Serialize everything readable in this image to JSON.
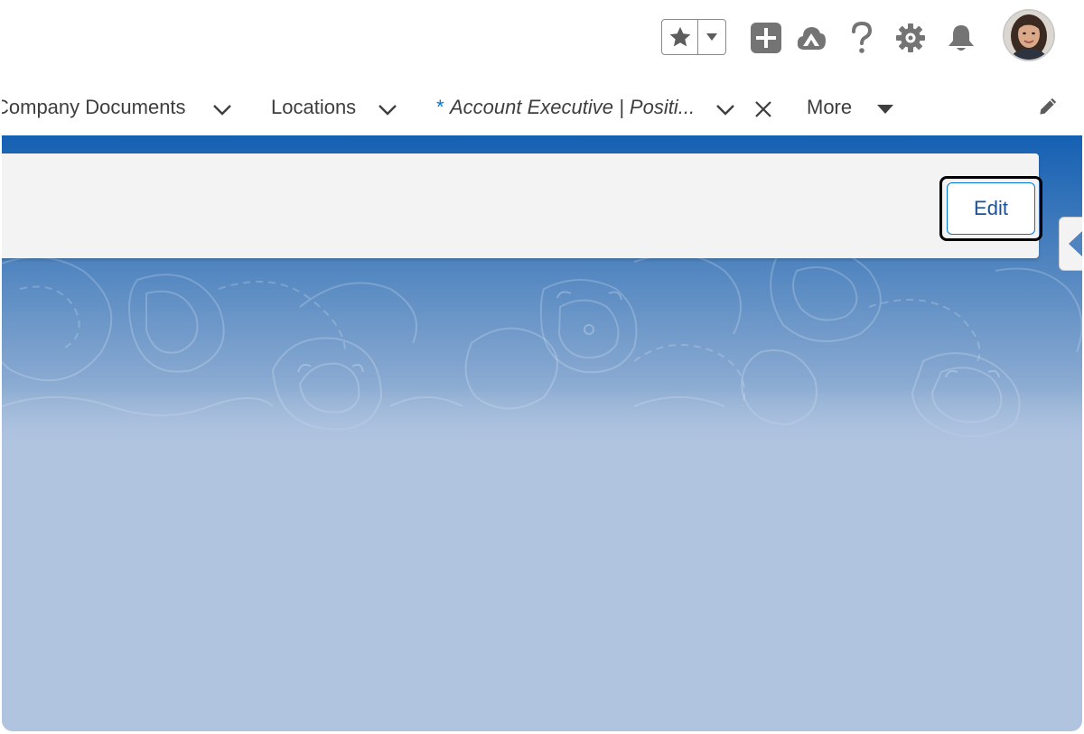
{
  "header": {
    "favorites_icon": "star-icon",
    "favorites_menu_icon": "caret-down-icon",
    "global_actions_icon": "plus-icon",
    "trailhead_icon": "trailhead-icon",
    "help_icon": "question-icon",
    "setup_icon": "gear-icon",
    "notifications_icon": "bell-icon",
    "avatar_icon": "user-avatar"
  },
  "nav": {
    "items": [
      {
        "label": "Company Documents"
      },
      {
        "label": "Locations"
      },
      {
        "modified_marker": "*",
        "label": "Account Executive | Positi..."
      }
    ],
    "more_label": "More",
    "edit_nav_icon": "pencil-icon"
  },
  "highlights": {
    "edit_label": "Edit"
  },
  "colors": {
    "brand_blue": "#1560b3",
    "button_text": "#1b5297",
    "button_border": "#0176d3",
    "panel_bg": "#f3f3f3",
    "icon_gray": "#747474"
  }
}
